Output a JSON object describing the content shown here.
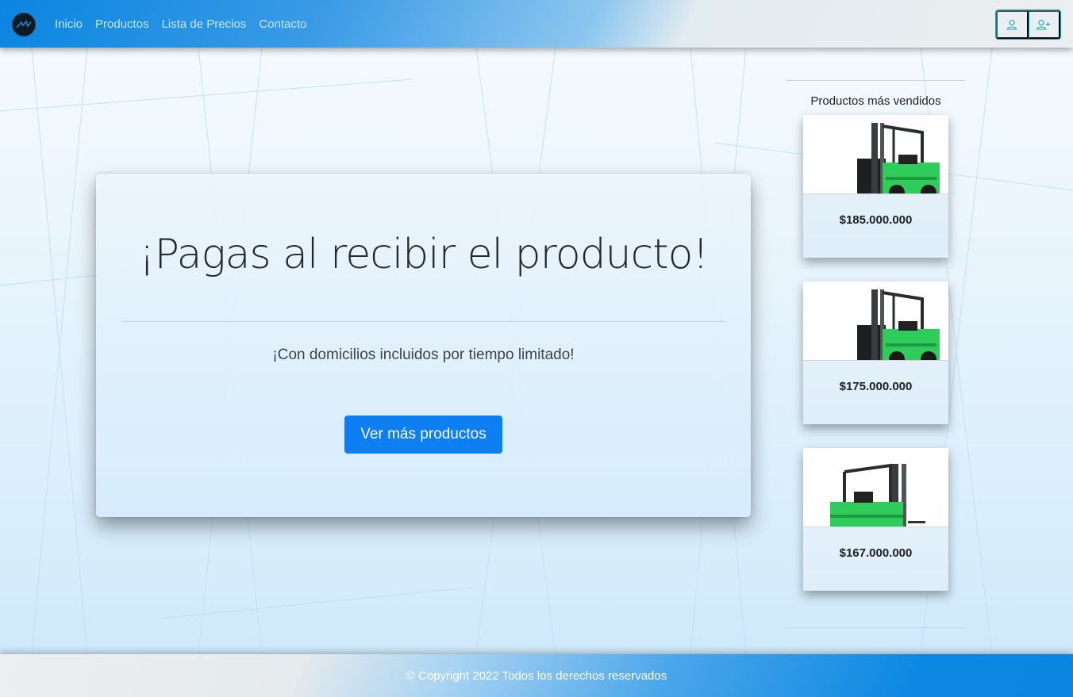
{
  "nav": {
    "links": [
      "Inicio",
      "Productos",
      "Lista de Precios",
      "Contacto"
    ],
    "icons": [
      "login-user-icon",
      "register-user-icon"
    ]
  },
  "hero": {
    "title": "¡Pagas al recibir el producto!",
    "subtitle": "¡Con domicilios incluidos por tiempo limitado!",
    "button_label": "Ver más productos"
  },
  "sidebar": {
    "title": "Productos más vendidos",
    "products": [
      {
        "price": "$185.000.000"
      },
      {
        "price": "$175.000.000"
      },
      {
        "price": "$167.000.000"
      }
    ]
  },
  "footer": {
    "text": "© Copyright 2022 Todos los derechos reservados"
  },
  "colors": {
    "primary": "#0d7ff2",
    "nav_gradient_start": "#0a85e0",
    "auth_border": "#1aa3b8",
    "forklift_green": "#2ecc5a"
  }
}
